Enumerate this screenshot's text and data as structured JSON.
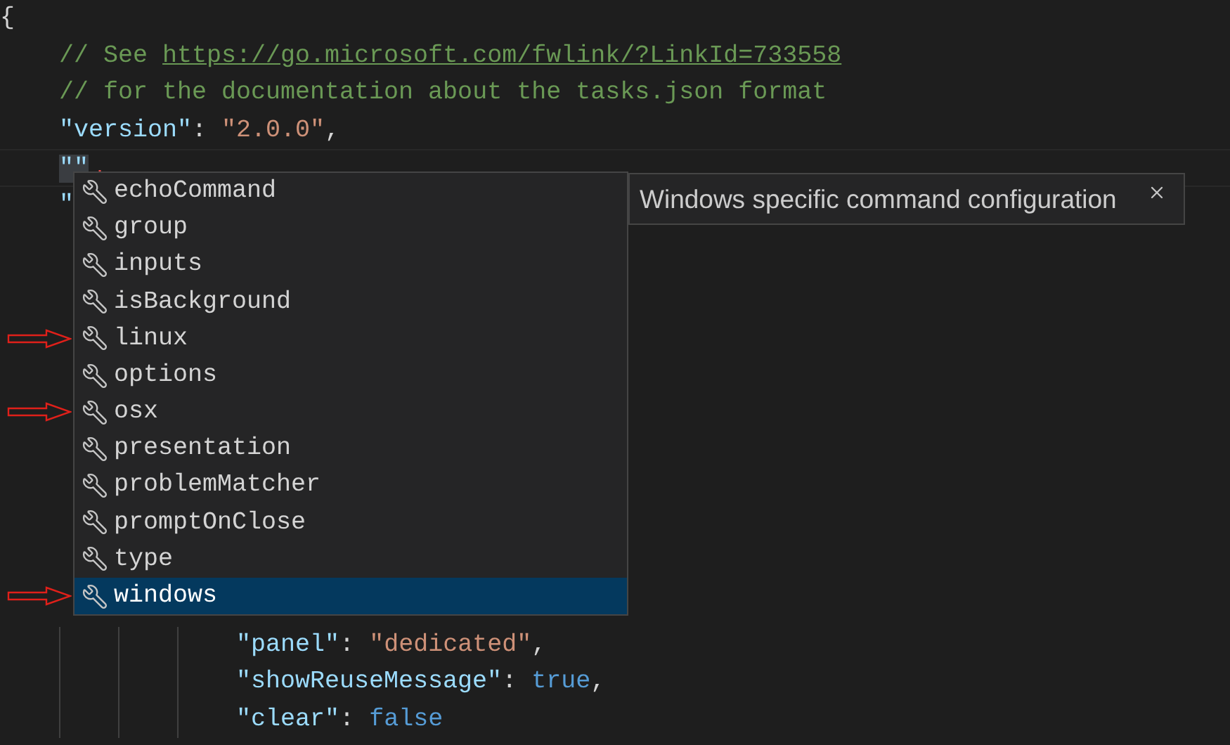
{
  "editor": {
    "lines_top": [
      {
        "current": false,
        "tokens": [
          {
            "kind": "punct",
            "text": "{"
          }
        ]
      },
      {
        "current": false,
        "tokens": [
          {
            "kind": "comment",
            "text": "    // See "
          },
          {
            "kind": "link",
            "text": "https://go.microsoft.com/fwlink/?LinkId=733558"
          }
        ]
      },
      {
        "current": false,
        "tokens": [
          {
            "kind": "comment",
            "text": "    // for the documentation about the tasks.json format"
          }
        ]
      },
      {
        "current": false,
        "tokens": [
          {
            "kind": "key",
            "text": "    \"version\""
          },
          {
            "kind": "punct",
            "text": ": "
          },
          {
            "kind": "string",
            "text": "\"2.0.0\""
          },
          {
            "kind": "punct",
            "text": ","
          }
        ]
      },
      {
        "current": true,
        "tokens": [
          {
            "kind": "selected",
            "text": "    \"\""
          }
        ]
      },
      {
        "current": false,
        "tokens": [
          {
            "kind": "key",
            "text": "    \""
          }
        ]
      }
    ],
    "lines_bottom": [
      {
        "current": false,
        "tokens": [
          {
            "kind": "key",
            "text": "                \"panel\""
          },
          {
            "kind": "punct",
            "text": ": "
          },
          {
            "kind": "string",
            "text": "\"dedicated\""
          },
          {
            "kind": "punct",
            "text": ","
          }
        ]
      },
      {
        "current": false,
        "tokens": [
          {
            "kind": "key",
            "text": "                \"showReuseMessage\""
          },
          {
            "kind": "punct",
            "text": ": "
          },
          {
            "kind": "bool",
            "text": "true"
          },
          {
            "kind": "punct",
            "text": ","
          }
        ]
      },
      {
        "current": false,
        "tokens": [
          {
            "kind": "key",
            "text": "                \"clear\""
          },
          {
            "kind": "punct",
            "text": ": "
          },
          {
            "kind": "bool",
            "text": "false"
          }
        ]
      }
    ]
  },
  "suggestions": [
    {
      "label": "echoCommand",
      "selected": false,
      "arrow": false
    },
    {
      "label": "group",
      "selected": false,
      "arrow": false
    },
    {
      "label": "inputs",
      "selected": false,
      "arrow": false
    },
    {
      "label": "isBackground",
      "selected": false,
      "arrow": false
    },
    {
      "label": "linux",
      "selected": false,
      "arrow": true
    },
    {
      "label": "options",
      "selected": false,
      "arrow": false
    },
    {
      "label": "osx",
      "selected": false,
      "arrow": true
    },
    {
      "label": "presentation",
      "selected": false,
      "arrow": false
    },
    {
      "label": "problemMatcher",
      "selected": false,
      "arrow": false
    },
    {
      "label": "promptOnClose",
      "selected": false,
      "arrow": false
    },
    {
      "label": "type",
      "selected": false,
      "arrow": false
    },
    {
      "label": "windows",
      "selected": true,
      "arrow": true
    }
  ],
  "details": {
    "text": "Windows specific command configuration"
  }
}
